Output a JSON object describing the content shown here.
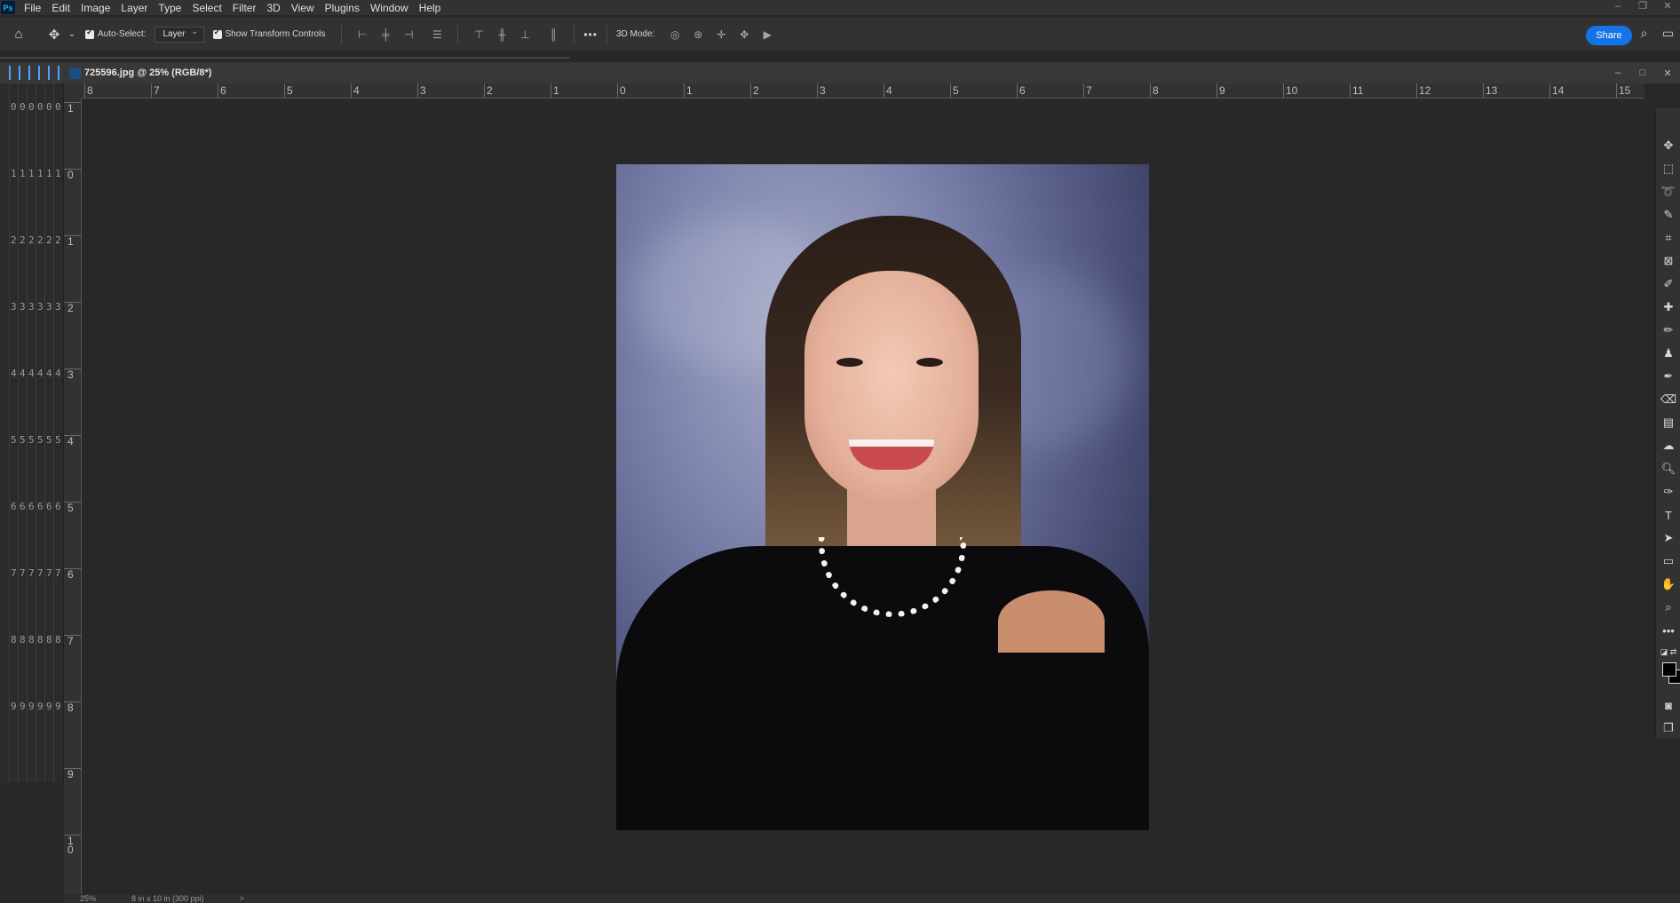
{
  "menubar": {
    "items": [
      "File",
      "Edit",
      "Image",
      "Layer",
      "Type",
      "Select",
      "Filter",
      "3D",
      "View",
      "Plugins",
      "Window",
      "Help"
    ],
    "window_controls": [
      "–",
      "❐",
      "✕"
    ]
  },
  "options": {
    "auto_select_label": "Auto-Select:",
    "auto_select_value": "Layer",
    "transform_label": "Show Transform Controls",
    "more_label": "•••",
    "mode_label": "3D Mode:",
    "share_label": "Share"
  },
  "document": {
    "title": "725596.jpg @ 25% (RGB/8*)",
    "controls": [
      "–",
      "□",
      "✕"
    ]
  },
  "hruler": {
    "labels": [
      "8",
      "7",
      "6",
      "5",
      "4",
      "3",
      "2",
      "1",
      "0",
      "1",
      "2",
      "3",
      "4",
      "5",
      "6",
      "7",
      "8",
      "9",
      "10",
      "11",
      "12",
      "13",
      "14",
      "15"
    ]
  },
  "vruler": {
    "labels": [
      "1",
      "0",
      "1",
      "2",
      "3",
      "4",
      "5",
      "6",
      "7",
      "8",
      "9",
      "1 0"
    ]
  },
  "leftstrip": {
    "labels": [
      "0",
      "1",
      "2",
      "3",
      "4",
      "5",
      "6",
      "7",
      "8",
      "9"
    ]
  },
  "status": {
    "zoom": "25%",
    "size": "8 in x 10 in (300 ppi)",
    "arrow": ">"
  },
  "colors": {
    "accent": "#1473e6",
    "foreground": "#000000",
    "background": "#000000"
  }
}
